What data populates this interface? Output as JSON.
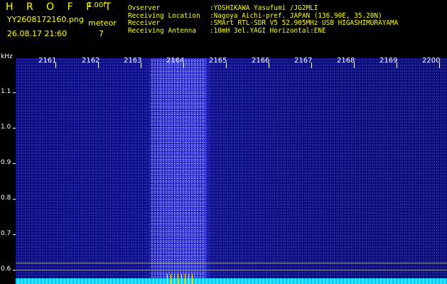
{
  "header": {
    "app_title": "H R O F F T",
    "app_version": "1.00f",
    "file_name": "YY2608172160.png",
    "mode_label": "meteor",
    "date_time": "26.08.17 21:60",
    "event_count": "7",
    "info": [
      {
        "label": "Ovserver",
        "value": ":YOSHIKAWA Yasufumi /JG2MLI"
      },
      {
        "label": "Receiving Location",
        "value": ":Nagoya Aichi-pref. JAPAN (136.90E, 35.20N)"
      },
      {
        "label": "Receiver",
        "value": ":SMArt RTL-SDR V5 52.905MHz USB HIGASHIMURAYAMA"
      },
      {
        "label": "Receiving Antenna",
        "value": ":10mH 3el.YAGI Horizontal:ENE"
      }
    ]
  },
  "axis": {
    "unit": "kHz",
    "freq_labels": [
      "2161",
      "2162",
      "2163",
      "2164",
      "2165",
      "2166",
      "2167",
      "2168",
      "2169",
      "2200"
    ],
    "y_labels": [
      "1.1",
      "1.0",
      "0.9",
      "0.8",
      "0.7",
      "0.6"
    ]
  },
  "colors": {
    "header_text": "#ffff00",
    "axis_text": "#ffffff",
    "background": "#000000",
    "trace": "#19d9ff",
    "spectrum_base": "#0a0a7a"
  }
}
